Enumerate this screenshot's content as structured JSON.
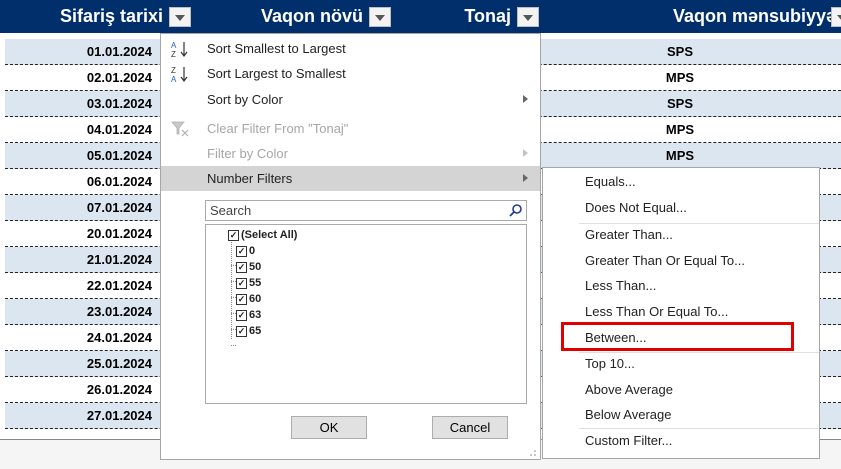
{
  "columns": [
    {
      "label": "Sifariş tarixi"
    },
    {
      "label": "Vaqon növü"
    },
    {
      "label": "Tonaj"
    },
    {
      "label": "Vaqon mənsubiyyəti"
    }
  ],
  "rows": [
    {
      "date": "01.01.2024",
      "owner": "SPS"
    },
    {
      "date": "02.01.2024",
      "owner": "MPS"
    },
    {
      "date": "03.01.2024",
      "owner": "SPS"
    },
    {
      "date": "04.01.2024",
      "owner": "MPS"
    },
    {
      "date": "05.01.2024",
      "owner": "MPS"
    },
    {
      "date": "06.01.2024",
      "owner": ""
    },
    {
      "date": "07.01.2024",
      "owner": ""
    },
    {
      "date": "20.01.2024",
      "owner": ""
    },
    {
      "date": "21.01.2024",
      "owner": ""
    },
    {
      "date": "22.01.2024",
      "owner": ""
    },
    {
      "date": "23.01.2024",
      "owner": ""
    },
    {
      "date": "24.01.2024",
      "owner": ""
    },
    {
      "date": "25.01.2024",
      "owner": ""
    },
    {
      "date": "26.01.2024",
      "owner": ""
    },
    {
      "date": "27.01.2024",
      "owner": ""
    }
  ],
  "filter_menu": {
    "sort_asc": "Sort Smallest to Largest",
    "sort_desc": "Sort Largest to Smallest",
    "sort_by_color": "Sort by Color",
    "clear_filter": "Clear Filter From \"Tonaj\"",
    "filter_by_color": "Filter by Color",
    "number_filters": "Number Filters",
    "search_placeholder": "Search",
    "values": [
      {
        "label": "(Select All)",
        "checked": true
      },
      {
        "label": "0",
        "checked": true
      },
      {
        "label": "50",
        "checked": true
      },
      {
        "label": "55",
        "checked": true
      },
      {
        "label": "60",
        "checked": true
      },
      {
        "label": "63",
        "checked": true
      },
      {
        "label": "65",
        "checked": true
      }
    ],
    "ok": "OK",
    "cancel": "Cancel"
  },
  "number_filters_submenu": {
    "items": [
      "Equals...",
      "Does Not Equal...",
      "Greater Than...",
      "Greater Than Or Equal To...",
      "Less Than...",
      "Less Than Or Equal To...",
      "Between...",
      "Top 10...",
      "Above Average",
      "Below Average",
      "Custom Filter..."
    ],
    "highlighted": "Between..."
  },
  "colors": {
    "header_bg": "#002f6c",
    "row_band": "#dce6f1",
    "menu_hover": "#d4d4d4",
    "highlight_box": "#e00000"
  },
  "icons": [
    "sort-ascending-icon",
    "sort-descending-icon",
    "clear-filter-icon",
    "search-icon",
    "dropdown-arrow-icon",
    "submenu-arrow-icon",
    "checkbox-icon"
  ]
}
